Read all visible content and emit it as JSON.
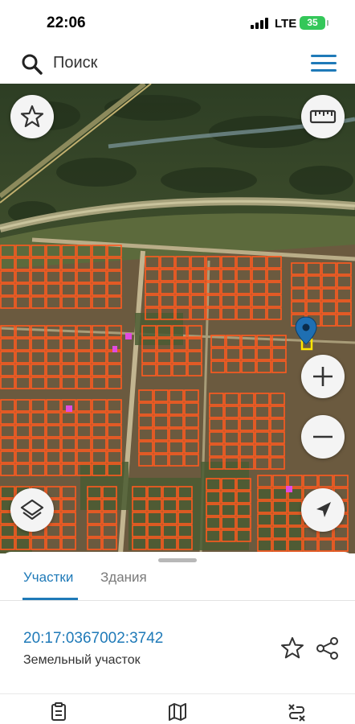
{
  "status_bar": {
    "time": "22:06",
    "network": "LTE",
    "battery": "35"
  },
  "search": {
    "placeholder": "Поиск"
  },
  "map": {
    "icons": [
      "star-icon",
      "ruler-icon",
      "location-pin-icon",
      "plus-icon",
      "minus-icon",
      "layers-icon",
      "navigation-arrow-icon"
    ]
  },
  "sheet": {
    "tabs": [
      {
        "label": "Участки",
        "active": true
      },
      {
        "label": "Здания",
        "active": false
      }
    ],
    "cadastral_number": "20:17:0367002:3742",
    "parcel_type": "Земельный участок"
  },
  "bottom_nav": {
    "icons": [
      "list-icon",
      "map-icon",
      "route-icon"
    ]
  },
  "colors": {
    "accent": "#1f7ab8",
    "parcel_outline": "#ff5a1f",
    "selected_parcel": "#ffe600"
  }
}
